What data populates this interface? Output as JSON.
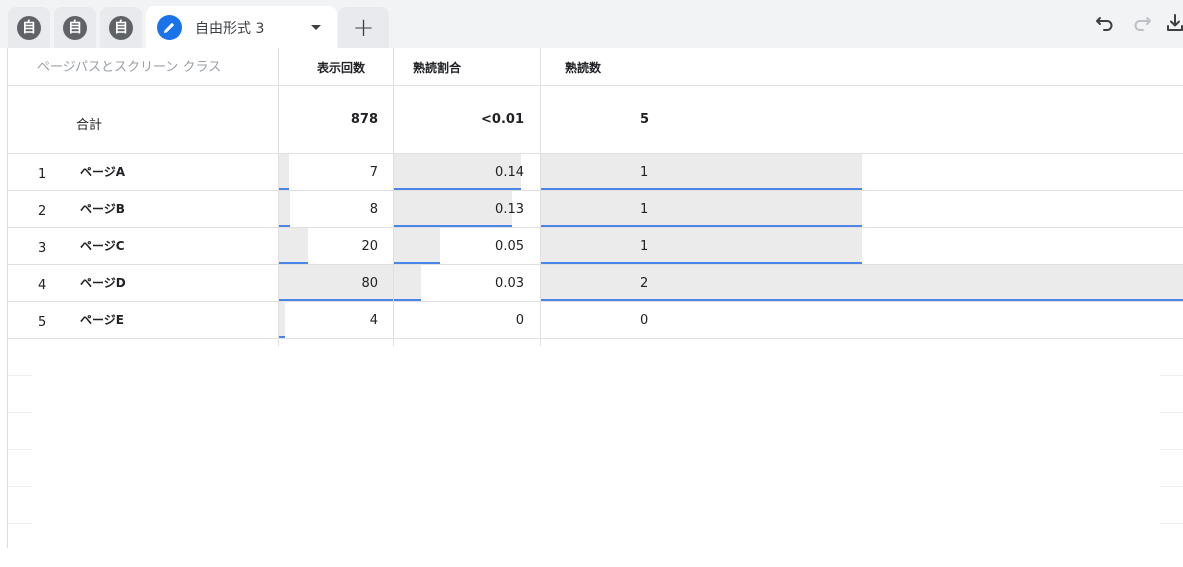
{
  "tabs": {
    "mini": [
      {
        "glyph": "自"
      },
      {
        "glyph": "自"
      },
      {
        "glyph": "自"
      }
    ],
    "active": {
      "title": "自由形式 3"
    },
    "add_glyph": "+"
  },
  "toolbar": {
    "icons": [
      "undo-icon",
      "redo-icon",
      "download-icon"
    ]
  },
  "table": {
    "columns": {
      "dimension": "ページパスとスクリーン クラス",
      "views": "表示回数",
      "engagement_rate": "熟読割合",
      "engaged_sessions": "熟読数"
    },
    "total": {
      "label": "合計",
      "views": "878",
      "rate": "<0.01",
      "engaged": "5"
    },
    "rows": [
      {
        "index": "1",
        "page": "ページA",
        "views": "7",
        "rate": "0.14",
        "engaged": "1",
        "views_share": 0.088,
        "rate_share": 1.0,
        "engaged_share": 0.5
      },
      {
        "index": "2",
        "page": "ページB",
        "views": "8",
        "rate": "0.13",
        "engaged": "1",
        "views_share": 0.1,
        "rate_share": 0.93,
        "engaged_share": 0.5
      },
      {
        "index": "3",
        "page": "ページC",
        "views": "20",
        "rate": "0.05",
        "engaged": "1",
        "views_share": 0.25,
        "rate_share": 0.36,
        "engaged_share": 0.5
      },
      {
        "index": "4",
        "page": "ページD",
        "views": "80",
        "rate": "0.03",
        "engaged": "2",
        "views_share": 1.0,
        "rate_share": 0.21,
        "engaged_share": 1.0
      },
      {
        "index": "5",
        "page": "ページE",
        "views": "4",
        "rate": "0",
        "engaged": "0",
        "views_share": 0.05,
        "rate_share": 0,
        "engaged_share": 0
      }
    ]
  },
  "colors": {
    "bar_fill": "#ebebeb",
    "bar_line": "#4a86e8",
    "accent": "#1a73e8"
  }
}
